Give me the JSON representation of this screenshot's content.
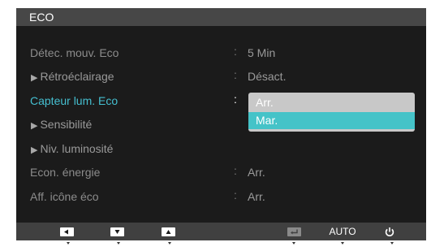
{
  "title": "ECO",
  "rows": [
    {
      "label": "Détec. mouv. Eco",
      "value": "5 Min"
    },
    {
      "label": "Rétroéclairage",
      "value": "Désact."
    },
    {
      "label": "Capteur lum. Eco",
      "value": ""
    },
    {
      "label": "Sensibilité",
      "value": ""
    },
    {
      "label": "Niv. luminosité",
      "value": ""
    },
    {
      "label": "Econ. énergie",
      "value": "Arr."
    },
    {
      "label": "Aff. icône éco",
      "value": "Arr."
    }
  ],
  "separator": ":",
  "dropdown": {
    "options": [
      "Arr.",
      "Mar."
    ],
    "selected": "Mar."
  },
  "bottom_buttons": {
    "left_icon": "left-arrow-key-icon",
    "down_icon": "down-arrow-key-icon",
    "up_icon": "up-arrow-key-icon",
    "enter_icon": "enter-key-icon",
    "auto_label": "AUTO",
    "power_icon": "power-icon"
  },
  "colors": {
    "accent": "#45bfd0",
    "selected_option": "#45c3c8",
    "background": "#1b1b1b"
  }
}
